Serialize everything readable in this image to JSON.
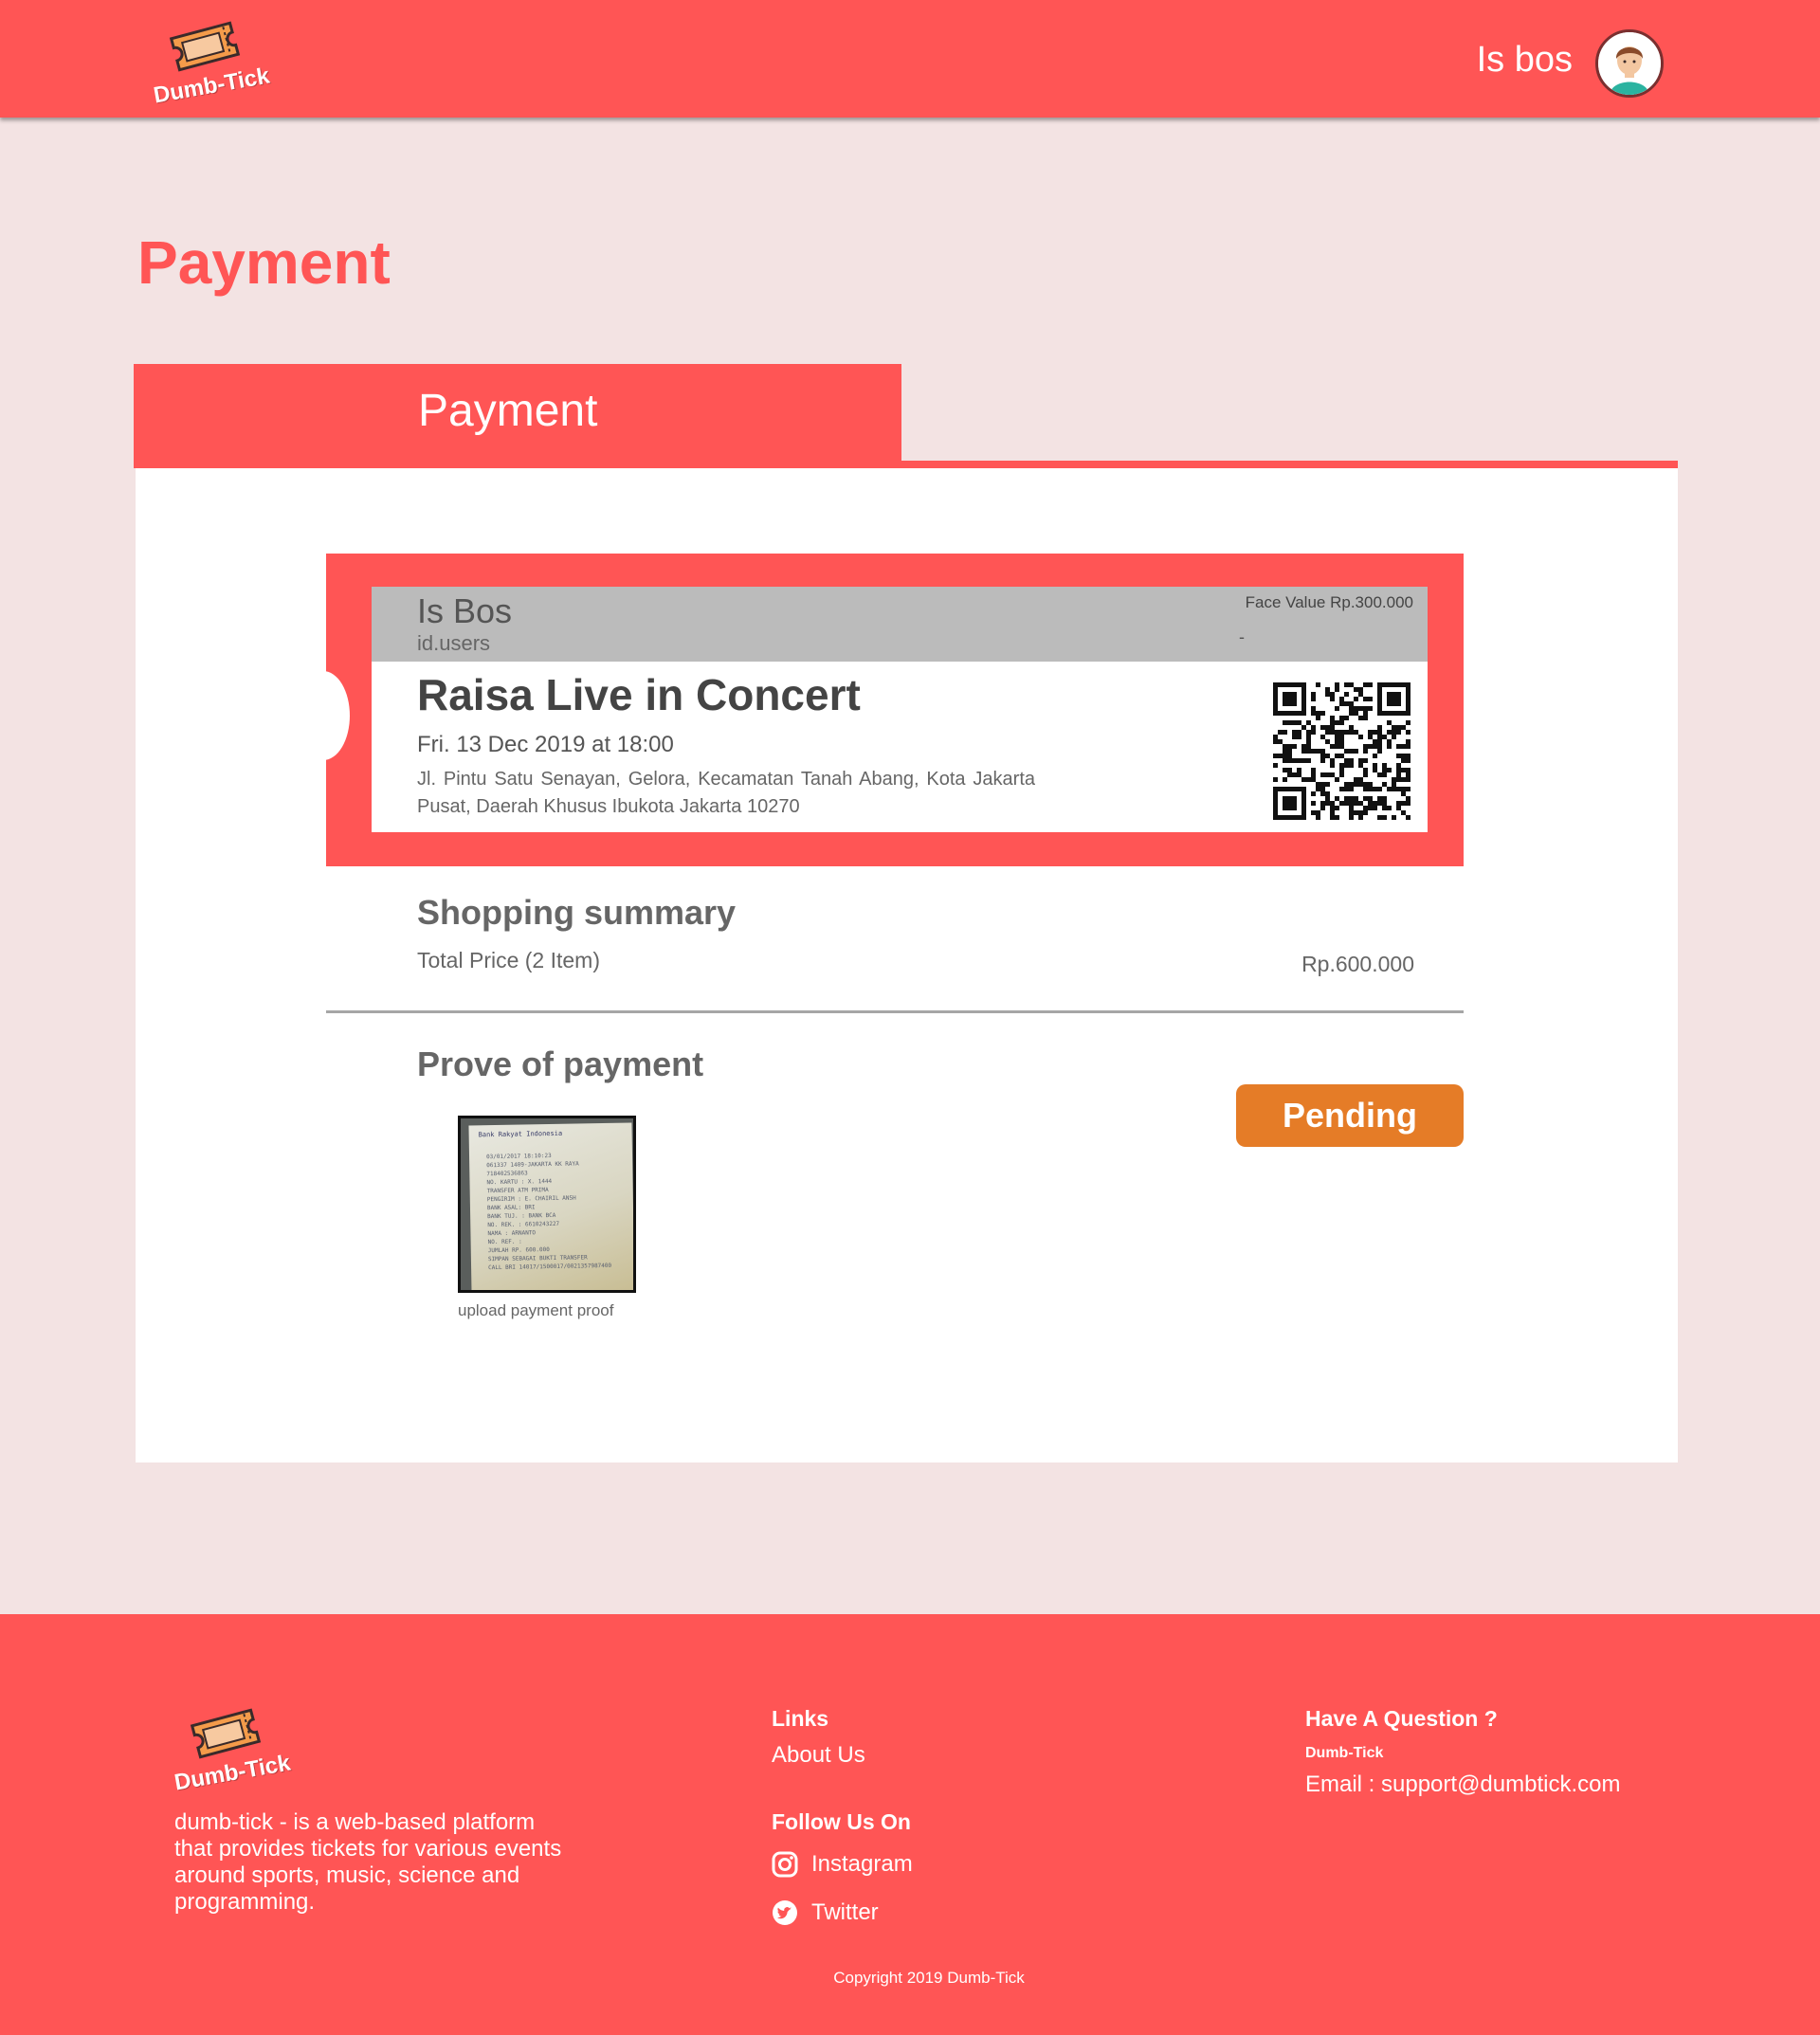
{
  "header": {
    "brand": "Dumb-Tick",
    "user_name": "Is bos"
  },
  "page_title": "Payment",
  "tab": {
    "label": "Payment"
  },
  "ticket": {
    "holder_name": "Is Bos",
    "holder_id": "id.users",
    "face_value": "Face Value Rp.300.000",
    "face_value_sub": "-",
    "event_title": "Raisa Live in Concert",
    "event_date": "Fri. 13 Dec 2019 at 18:00",
    "event_address": "Jl. Pintu Satu Senayan, Gelora, Kecamatan Tanah Abang, Kota Jakarta Pusat, Daerah Khusus Ibukota Jakarta 10270"
  },
  "summary": {
    "title": "Shopping summary",
    "total_label": "Total Price (2 Item)",
    "total_value": "Rp.600.000"
  },
  "proof": {
    "title": "Prove of payment",
    "caption": "upload payment proof",
    "status_label": "Pending",
    "receipt_lines": [
      "Bank Rakyat Indonesia",
      "03/01/2017  18:10:23",
      "061337 1409-JAKARTA KK RAYA",
      "718402536863",
      "NO. KARTU : X. 1444",
      "TRANSFER ATM PRIMA",
      "PENGIRIM : E. CHAIRIL ANSH",
      "BANK ASAL: BRI",
      "BANK TUJ. : BANK BCA",
      "NO. REK.  : 6610243227",
      "NAMA      : ARNANTO",
      "NO. REF.  :",
      "JUMLAH    RP.     600.000",
      "SIMPAN SEBAGAI BUKTI TRANSFER",
      "CALL BRI 14017/1500017/0021357987400"
    ]
  },
  "footer": {
    "brand": "Dumb-Tick",
    "description": "dumb-tick - is a web-based platform that provides tickets for various events around sports, music, science and programming.",
    "links_heading": "Links",
    "about_link": "About Us",
    "follow_heading": "Follow Us On",
    "instagram": "Instagram",
    "twitter": "Twitter",
    "question_heading": "Have A Question ?",
    "question_brand": "Dumb-Tick",
    "email": "Email : support@dumbtick.com",
    "copyright": "Copyright 2019 Dumb-Tick"
  },
  "colors": {
    "brand_red": "#ff5555",
    "page_bg": "#f3e3e3",
    "status_orange": "#e57c27",
    "ticket_head_gray": "#bbbbbb"
  },
  "icons": {
    "logo": "ticket-icon",
    "avatar": "user-avatar-icon",
    "qr": "qr-code-icon",
    "instagram": "instagram-icon",
    "twitter": "twitter-icon"
  }
}
